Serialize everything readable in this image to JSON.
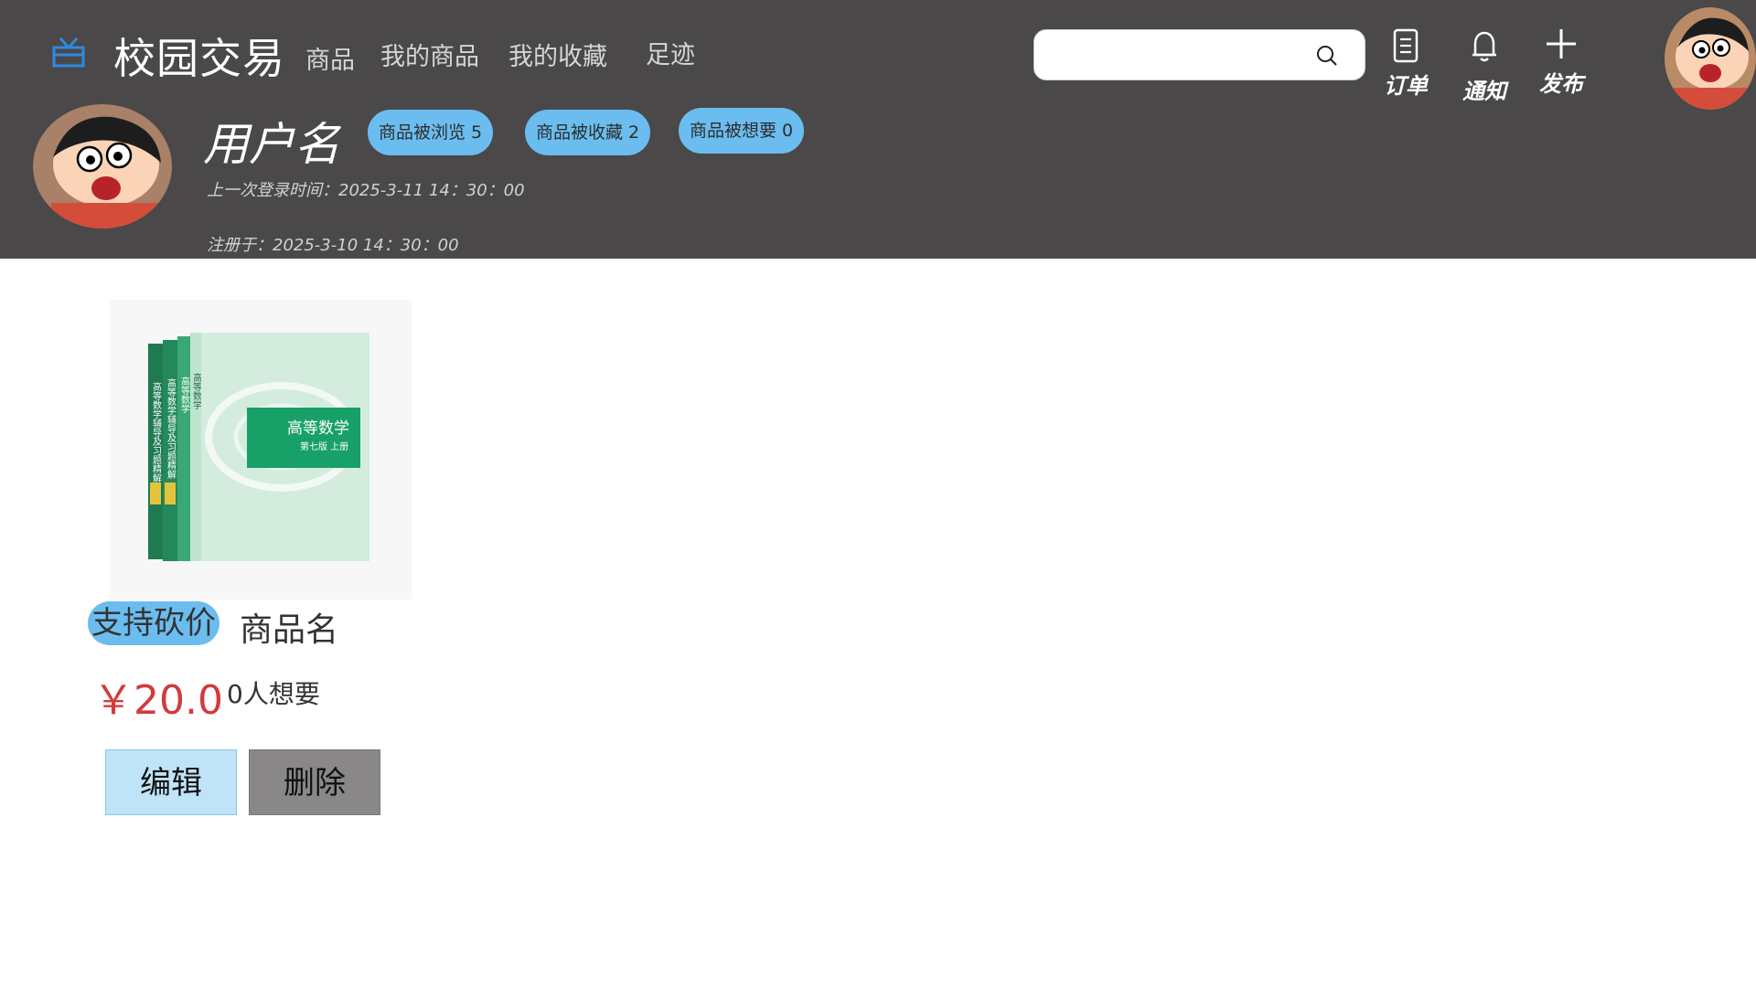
{
  "nav": {
    "brand": "校园交易",
    "links": [
      "商品",
      "我的商品",
      "我的收藏",
      "足迹"
    ]
  },
  "search": {
    "value": "",
    "placeholder": ""
  },
  "actions": {
    "orders": "订单",
    "notifications": "通知",
    "publish": "发布"
  },
  "profile": {
    "username": "用户名",
    "stats": [
      "商品被浏览 5",
      "商品被收藏 2",
      "商品被想要 0"
    ],
    "last_login": "上一次登录时间：2025-3-11  14：30：00",
    "registered": "注册于：2025-3-10 14：30：00"
  },
  "product": {
    "badge": "支持砍价",
    "name": "商品名",
    "price": "￥20.0",
    "want": "0人想要",
    "cover_title": "高等数学",
    "cover_edition": "第七版 上册",
    "spine_1": "高等数学辅导及习题精解",
    "spine_2": "高等数学辅导及习题精解",
    "spine_3": "高等数学",
    "spine_4": "高等数学"
  },
  "buttons": {
    "edit": "编辑",
    "delete": "删除"
  },
  "colors": {
    "header_bg": "#4a4849",
    "pill": "#6bbdf0",
    "price": "#d33a3a",
    "edit_bg": "#bfe4f7",
    "delete_bg": "#8a8788"
  },
  "icons": [
    "gift-icon",
    "search-icon",
    "document-icon",
    "bell-icon",
    "plus-icon"
  ]
}
